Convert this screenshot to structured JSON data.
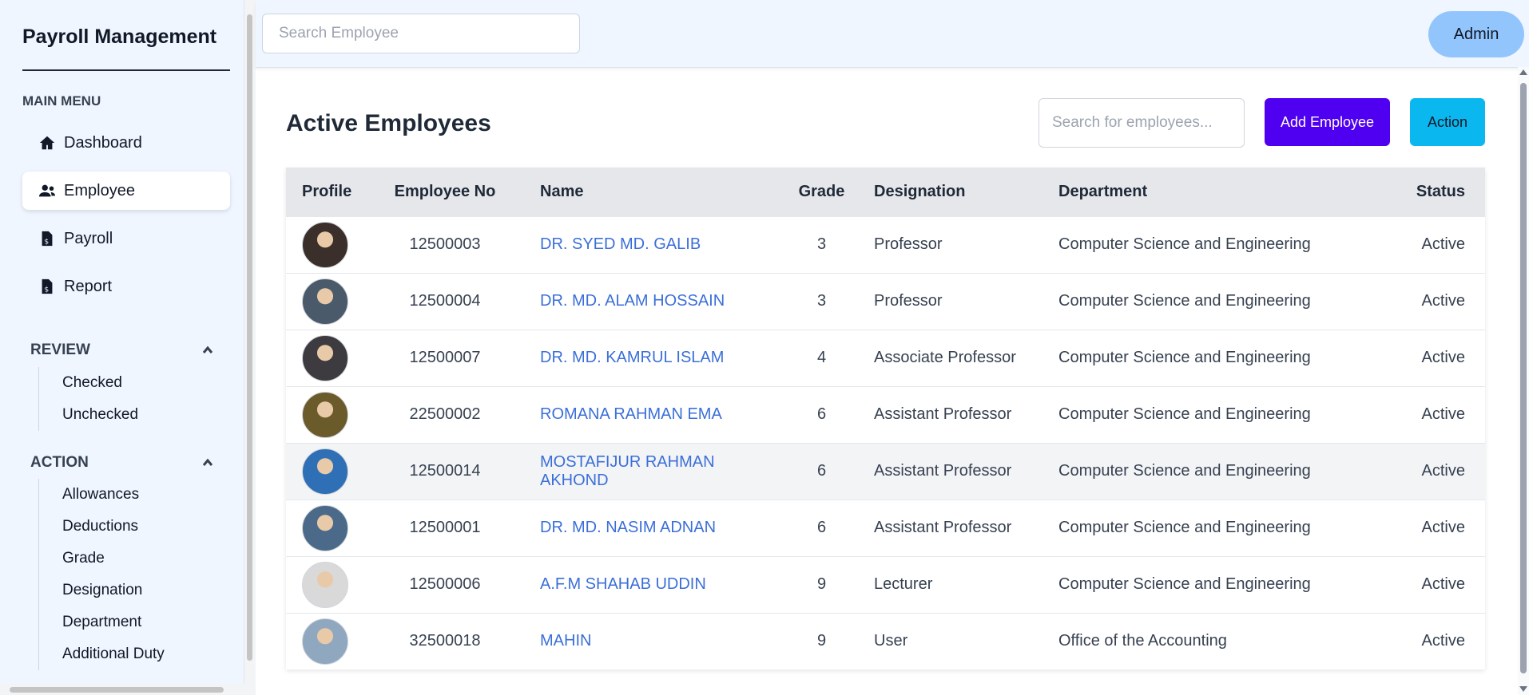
{
  "sidebar": {
    "brand": "Payroll Management",
    "main_menu_heading": "MAIN MENU",
    "nav": [
      {
        "label": "Dashboard",
        "icon": "home-icon"
      },
      {
        "label": "Employee",
        "icon": "users-icon",
        "active": true
      },
      {
        "label": "Payroll",
        "icon": "invoice-icon"
      },
      {
        "label": "Report",
        "icon": "invoice-icon"
      }
    ],
    "review": {
      "heading": "REVIEW",
      "items": [
        "Checked",
        "Unchecked"
      ]
    },
    "action": {
      "heading": "ACTION",
      "items": [
        "Allowances",
        "Deductions",
        "Grade",
        "Designation",
        "Department",
        "Additional Duty"
      ]
    }
  },
  "topbar": {
    "search_placeholder": "Search Employee",
    "admin_label": "Admin"
  },
  "main": {
    "title": "Active Employees",
    "search_placeholder": "Search for employees...",
    "add_button": "Add Employee",
    "action_button": "Action",
    "columns": [
      "Profile",
      "Employee No",
      "Name",
      "Grade",
      "Designation",
      "Department",
      "Status"
    ],
    "rows": [
      {
        "employee_no": "12500003",
        "name": "DR. SYED MD. GALIB",
        "grade": "3",
        "designation": "Professor",
        "department": "Computer Science and Engineering",
        "status": "Active",
        "avatar_color": "#3a2f2a"
      },
      {
        "employee_no": "12500004",
        "name": "DR. MD. ALAM HOSSAIN",
        "grade": "3",
        "designation": "Professor",
        "department": "Computer Science and Engineering",
        "status": "Active",
        "avatar_color": "#4a5a6a"
      },
      {
        "employee_no": "12500007",
        "name": "DR. MD. KAMRUL ISLAM",
        "grade": "4",
        "designation": "Associate Professor",
        "department": "Computer Science and Engineering",
        "status": "Active",
        "avatar_color": "#3d3a40"
      },
      {
        "employee_no": "22500002",
        "name": "ROMANA RAHMAN EMA",
        "grade": "6",
        "designation": "Assistant Professor",
        "department": "Computer Science and Engineering",
        "status": "Active",
        "avatar_color": "#6b5a2a"
      },
      {
        "employee_no": "12500014",
        "name": "MOSTAFIJUR RAHMAN AKHOND",
        "grade": "6",
        "designation": "Assistant Professor",
        "department": "Computer Science and Engineering",
        "status": "Active",
        "avatar_color": "#2f6fb5"
      },
      {
        "employee_no": "12500001",
        "name": "DR. MD. NASIM ADNAN",
        "grade": "6",
        "designation": "Assistant Professor",
        "department": "Computer Science and Engineering",
        "status": "Active",
        "avatar_color": "#4b6a8a"
      },
      {
        "employee_no": "12500006",
        "name": "A.F.M SHAHAB UDDIN",
        "grade": "9",
        "designation": "Lecturer",
        "department": "Computer Science and Engineering",
        "status": "Active",
        "avatar_color": "#d9d9d9"
      },
      {
        "employee_no": "32500018",
        "name": "MAHIN",
        "grade": "9",
        "designation": "User",
        "department": "Office of the Accounting",
        "status": "Active",
        "avatar_color": "#8fa8c0"
      }
    ]
  }
}
